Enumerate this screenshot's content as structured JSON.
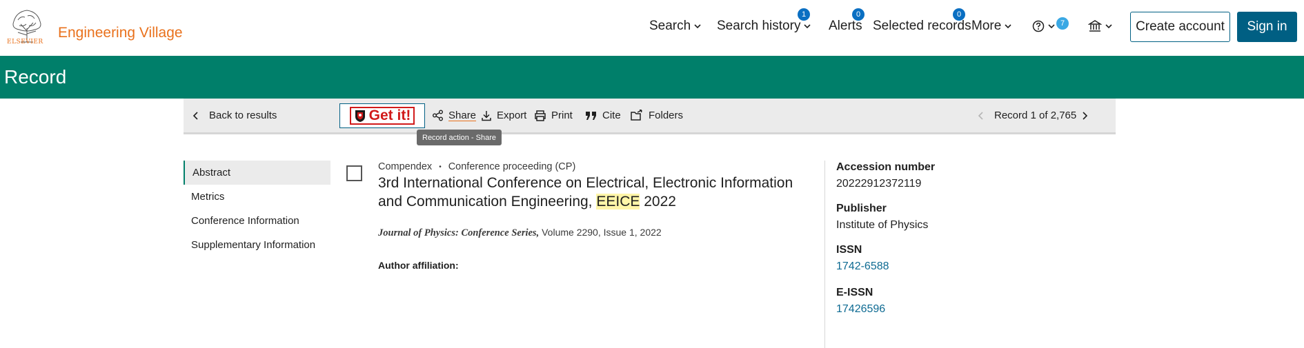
{
  "header": {
    "logo_text": "ELSEVIER",
    "brand": "Engineering Village",
    "nav": {
      "search": "Search",
      "search_history": "Search history",
      "search_history_count": "1",
      "alerts": "Alerts",
      "alerts_count": "0",
      "selected_records": "Selected records",
      "selected_records_count": "0",
      "more": "More",
      "help_count": "7"
    },
    "create_account": "Create account",
    "sign_in": "Sign in"
  },
  "banner": {
    "title": "Record"
  },
  "toolbar": {
    "back": "Back to results",
    "getit": "Get it!",
    "share": "Share",
    "export": "Export",
    "print": "Print",
    "cite": "Cite",
    "folders": "Folders",
    "record_pager": "Record 1 of 2,765",
    "tooltip": "Record action - Share"
  },
  "sidenav": {
    "items": [
      "Abstract",
      "Metrics",
      "Conference Information",
      "Supplementary Information"
    ]
  },
  "record": {
    "database": "Compendex",
    "doc_type": "Conference proceeding (CP)",
    "title_before": "3rd International Conference on Electrical, Electronic Information and Communication Engineering, ",
    "title_highlight": "EEICE",
    "title_after": " 2022",
    "journal": "Journal of Physics: Conference Series,",
    "journal_details": " Volume 2290, Issue 1, 2022",
    "author_affiliation_label": "Author affiliation:"
  },
  "details": {
    "accession_label": "Accession number",
    "accession_value": "20222912372119",
    "publisher_label": "Publisher",
    "publisher_value": "Institute of Physics",
    "issn_label": "ISSN",
    "issn_value": "1742-6588",
    "eissn_label": "E-ISSN",
    "eissn_value": "17426596"
  },
  "colors": {
    "brand_orange": "#e9711c",
    "banner_green": "#007f6a",
    "primary_blue": "#005f83",
    "badge_blue": "#0a6fc2",
    "link_blue": "#0d6a92",
    "highlight": "#fff5a8"
  }
}
